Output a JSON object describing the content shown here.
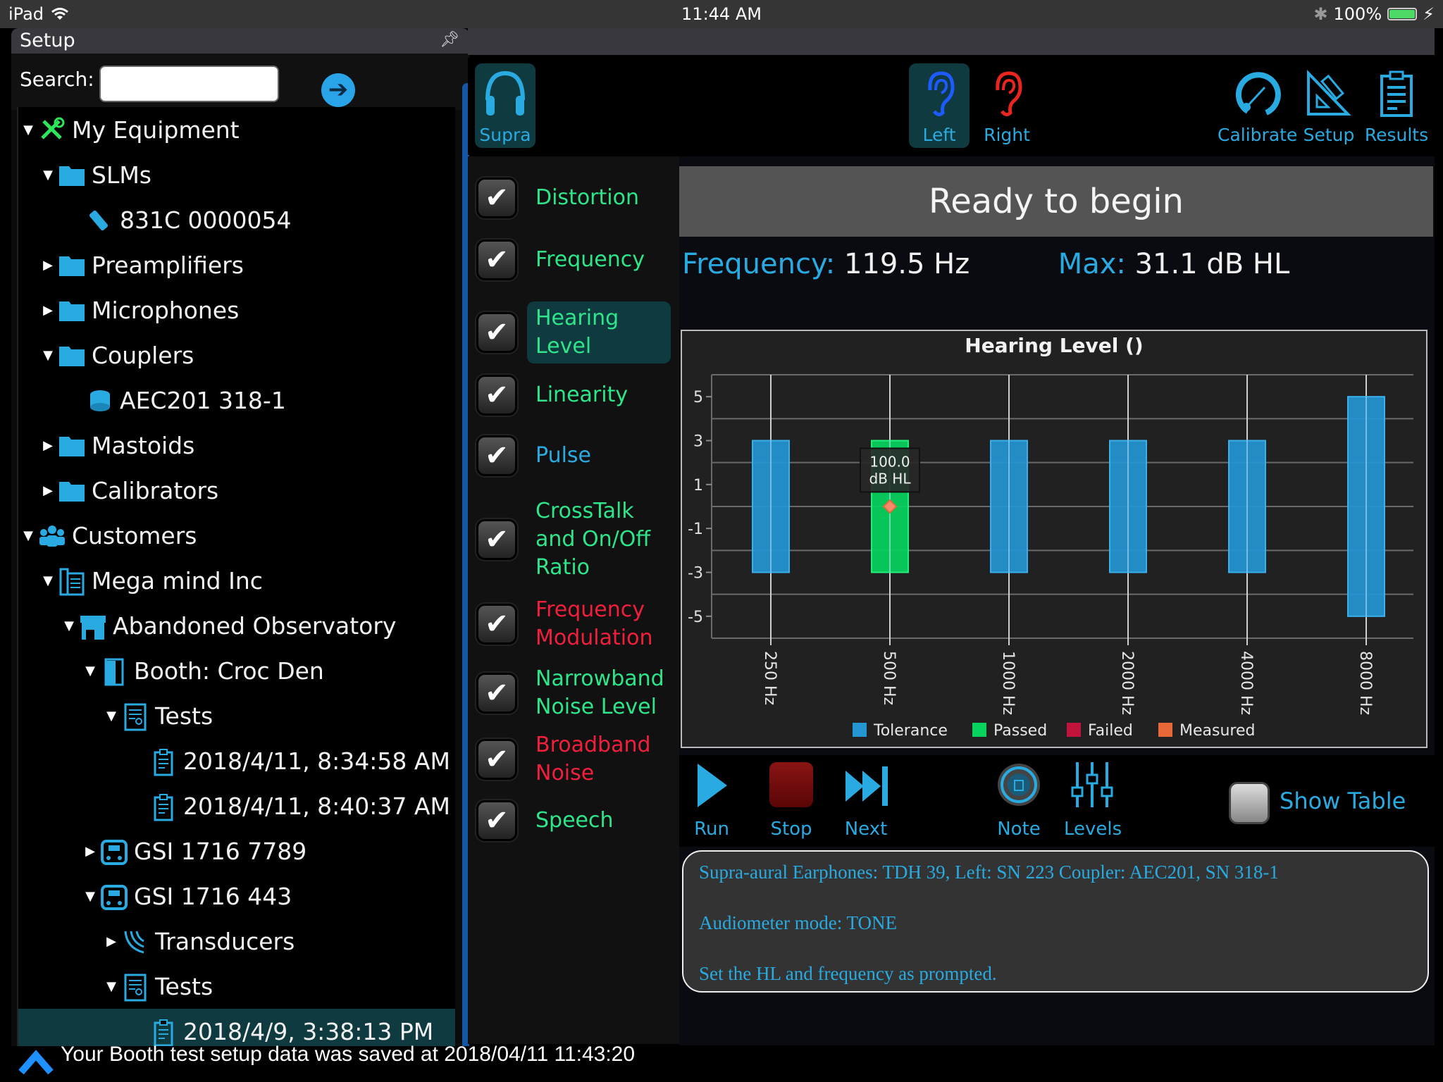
{
  "status_bar": {
    "device": "iPad",
    "time": "11:44 AM",
    "battery": "100%",
    "battery_level": 1.0
  },
  "setup_panel": {
    "title": "Setup",
    "search_label": "Search:",
    "search_value": "",
    "tree": [
      {
        "label": "My Equipment",
        "level": 0,
        "expanded": true,
        "icon": "tools-icon"
      },
      {
        "label": "SLMs",
        "level": 1,
        "expanded": true,
        "icon": "folder-icon"
      },
      {
        "label": "831C 0000054",
        "level": 2,
        "expanded": null,
        "icon": "sound-level-meter-icon"
      },
      {
        "label": "Preamplifiers",
        "level": 1,
        "expanded": false,
        "icon": "folder-icon"
      },
      {
        "label": "Microphones",
        "level": 1,
        "expanded": false,
        "icon": "folder-icon"
      },
      {
        "label": "Couplers",
        "level": 1,
        "expanded": true,
        "icon": "folder-icon"
      },
      {
        "label": "AEC201 318-1",
        "level": 2,
        "expanded": null,
        "icon": "coupler-icon"
      },
      {
        "label": "Mastoids",
        "level": 1,
        "expanded": false,
        "icon": "folder-icon"
      },
      {
        "label": "Calibrators",
        "level": 1,
        "expanded": false,
        "icon": "folder-icon"
      },
      {
        "label": "Customers",
        "level": 0,
        "expanded": true,
        "icon": "people-icon"
      },
      {
        "label": "Mega mind Inc",
        "level": 1,
        "expanded": true,
        "icon": "building-icon"
      },
      {
        "label": "Abandoned Observatory",
        "level": 2,
        "expanded": true,
        "icon": "store-icon"
      },
      {
        "label": "Booth: Croc Den",
        "level": 3,
        "expanded": true,
        "icon": "door-icon"
      },
      {
        "label": "Tests",
        "level": 4,
        "expanded": true,
        "icon": "certificate-icon"
      },
      {
        "label": "2018/4/11, 8:34:58 AM",
        "level": 5,
        "expanded": null,
        "icon": "clipboard-icon"
      },
      {
        "label": "2018/4/11, 8:40:37 AM",
        "level": 5,
        "expanded": null,
        "icon": "clipboard-icon"
      },
      {
        "label": "GSI 1716 7789",
        "level": 3,
        "expanded": false,
        "icon": "audiometer-icon"
      },
      {
        "label": "GSI 1716 443",
        "level": 3,
        "expanded": true,
        "icon": "audiometer-icon"
      },
      {
        "label": "Transducers",
        "level": 4,
        "expanded": false,
        "icon": "transducer-icon"
      },
      {
        "label": "Tests",
        "level": 4,
        "expanded": true,
        "icon": "certificate-icon"
      },
      {
        "label": "2018/4/9, 3:38:13 PM",
        "level": 5,
        "expanded": null,
        "icon": "clipboard-icon",
        "selected": true
      }
    ]
  },
  "toolbar": {
    "supra": "Supra",
    "left": "Left",
    "right": "Right",
    "calibrate": "Calibrate",
    "setup": "Setup",
    "results": "Results"
  },
  "tests": [
    {
      "label": "Distortion",
      "status": "green",
      "checked": true
    },
    {
      "label": "Frequency",
      "status": "green",
      "checked": true
    },
    {
      "label": "Hearing Level",
      "status": "green",
      "checked": true,
      "selected": true
    },
    {
      "label": "Linearity",
      "status": "green",
      "checked": true
    },
    {
      "label": "Pulse",
      "status": "blue",
      "checked": true
    },
    {
      "label": "CrossTalk and On/Off Ratio",
      "status": "green",
      "checked": true
    },
    {
      "label": "Frequency Modulation",
      "status": "red",
      "checked": true
    },
    {
      "label": "Narrowband Noise Level",
      "status": "green",
      "checked": true
    },
    {
      "label": "Broadband Noise",
      "status": "red",
      "checked": true
    },
    {
      "label": "Speech",
      "status": "green",
      "checked": true
    }
  ],
  "main": {
    "banner": "Ready to begin",
    "frequency_label": "Frequency:",
    "frequency_value": "119.5 Hz",
    "max_label": "Max:",
    "max_value": "31.1 dB HL"
  },
  "chart_data": {
    "type": "bar",
    "title": "Hearing Level ()",
    "categories": [
      "250 Hz",
      "500 Hz",
      "1000 Hz",
      "2000 Hz",
      "4000 Hz",
      "8000 Hz"
    ],
    "series": [
      {
        "name": "Tolerance",
        "color": "#2596d4",
        "ranges": [
          [
            -3,
            3
          ],
          null,
          [
            -3,
            3
          ],
          [
            -3,
            3
          ],
          [
            -3,
            3
          ],
          [
            -5,
            5
          ]
        ]
      },
      {
        "name": "Passed",
        "color": "#07d45f",
        "ranges": [
          null,
          [
            -3,
            3
          ],
          null,
          null,
          null,
          null
        ]
      },
      {
        "name": "Failed",
        "color": "#c0143c",
        "ranges": [
          null,
          null,
          null,
          null,
          null,
          null
        ]
      },
      {
        "name": "Measured",
        "color": "#e8683a",
        "points": [
          null,
          0,
          null,
          null,
          null,
          null
        ]
      }
    ],
    "ylim": [
      -6,
      6
    ],
    "yticks": [
      5,
      3,
      1,
      -1,
      -3,
      -5
    ],
    "gridlines": [
      6,
      4,
      2,
      0,
      -2,
      -4,
      -6
    ],
    "grid": true,
    "legend": "bottom",
    "tooltip": {
      "category": "500 Hz",
      "line1": "100.0",
      "line2": "dB HL"
    },
    "xlabel": "",
    "ylabel": ""
  },
  "controls": {
    "run": "Run",
    "stop": "Stop",
    "next": "Next",
    "note": "Note",
    "levels": "Levels",
    "show_table": "Show Table",
    "show_table_on": false
  },
  "info": {
    "line1": "Supra-aural Earphones: TDH 39, Left: SN 223 Coupler: AEC201, SN 318-1",
    "line2": "Audiometer mode: TONE",
    "line3": "Set the HL and frequency as prompted."
  },
  "footer": {
    "message": "Your Booth test setup data was saved at 2018/04/11 11:43:20"
  }
}
